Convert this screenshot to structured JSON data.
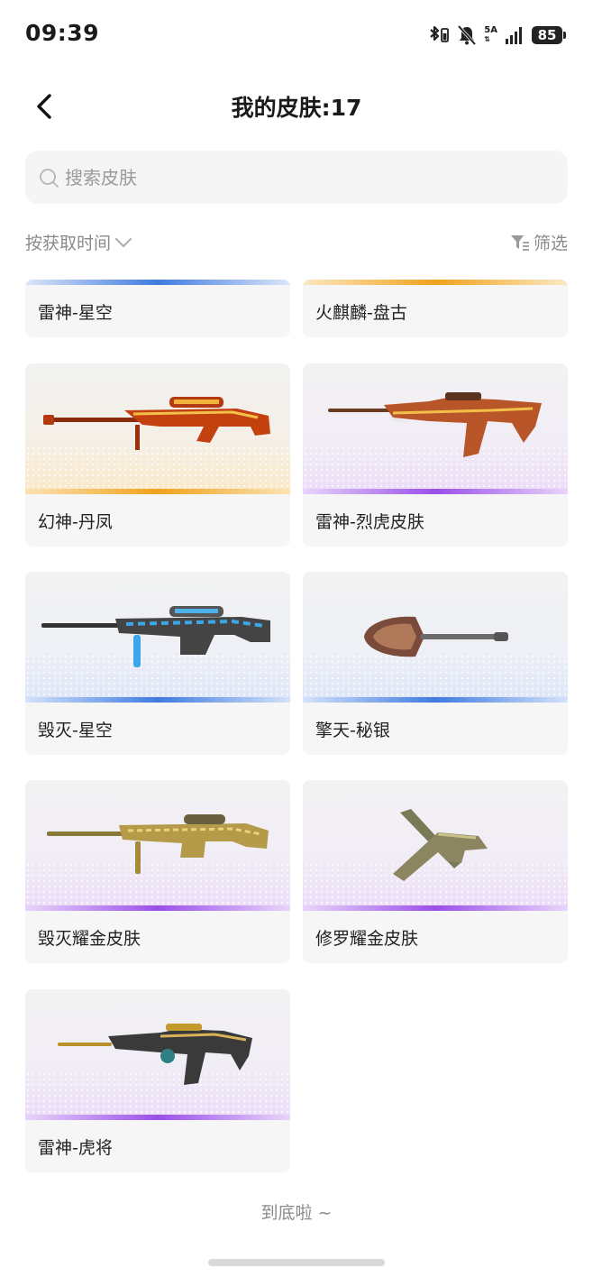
{
  "status_bar": {
    "time": "09:39",
    "network": "5A",
    "battery": "85",
    "icons": [
      "bluetooth-icon",
      "mute-icon",
      "signal-icon",
      "battery-icon"
    ]
  },
  "header": {
    "back_icon": "chevron-left-icon",
    "title": "我的皮肤:17"
  },
  "search": {
    "placeholder": "搜索皮肤",
    "value": ""
  },
  "toolbar": {
    "sort_label": "按获取时间",
    "filter_label": "筛选"
  },
  "colors": {
    "blue": "#3f7be0",
    "gold": "#f0a21c",
    "purple": "#9a4fe8"
  },
  "skins": [
    {
      "name": "雷神-星空",
      "rarity": "blue"
    },
    {
      "name": "火麒麟-盘古",
      "rarity": "gold"
    },
    {
      "name": "幻神-丹凤",
      "rarity": "gold"
    },
    {
      "name": "雷神-烈虎皮肤",
      "rarity": "purple"
    },
    {
      "name": "毁灭-星空",
      "rarity": "blue"
    },
    {
      "name": "擎天-秘银",
      "rarity": "blue"
    },
    {
      "name": "毁灭耀金皮肤",
      "rarity": "purple"
    },
    {
      "name": "修罗耀金皮肤",
      "rarity": "purple"
    },
    {
      "name": "雷神-虎将",
      "rarity": "purple"
    }
  ],
  "footer": {
    "end_text": "到底啦 ~"
  }
}
